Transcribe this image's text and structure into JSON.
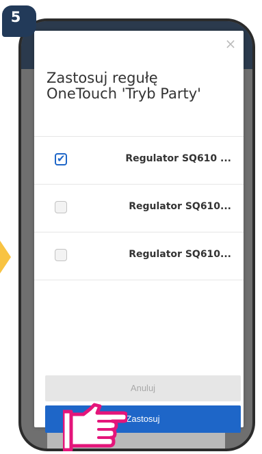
{
  "step": {
    "number": "5"
  },
  "dialog": {
    "title_line1": "Zastosuj regułę",
    "title_line2": "OneTouch 'Tryb Party'",
    "close_icon": "×",
    "devices": [
      {
        "label": "Regulator SQ610 ...",
        "checked": true
      },
      {
        "label": "Regulator SQ610...",
        "checked": false
      },
      {
        "label": "Regulator SQ610...",
        "checked": false
      }
    ],
    "cancel_label": "Anuluj",
    "apply_label": "Zastosuj"
  },
  "colors": {
    "primary": "#1e66c8",
    "badge": "#223a59",
    "hand": "#e4157a",
    "arrow": "#f8c342"
  },
  "icons": {
    "close": "close-icon",
    "check": "check-icon",
    "hand": "hand-pointer-icon"
  }
}
